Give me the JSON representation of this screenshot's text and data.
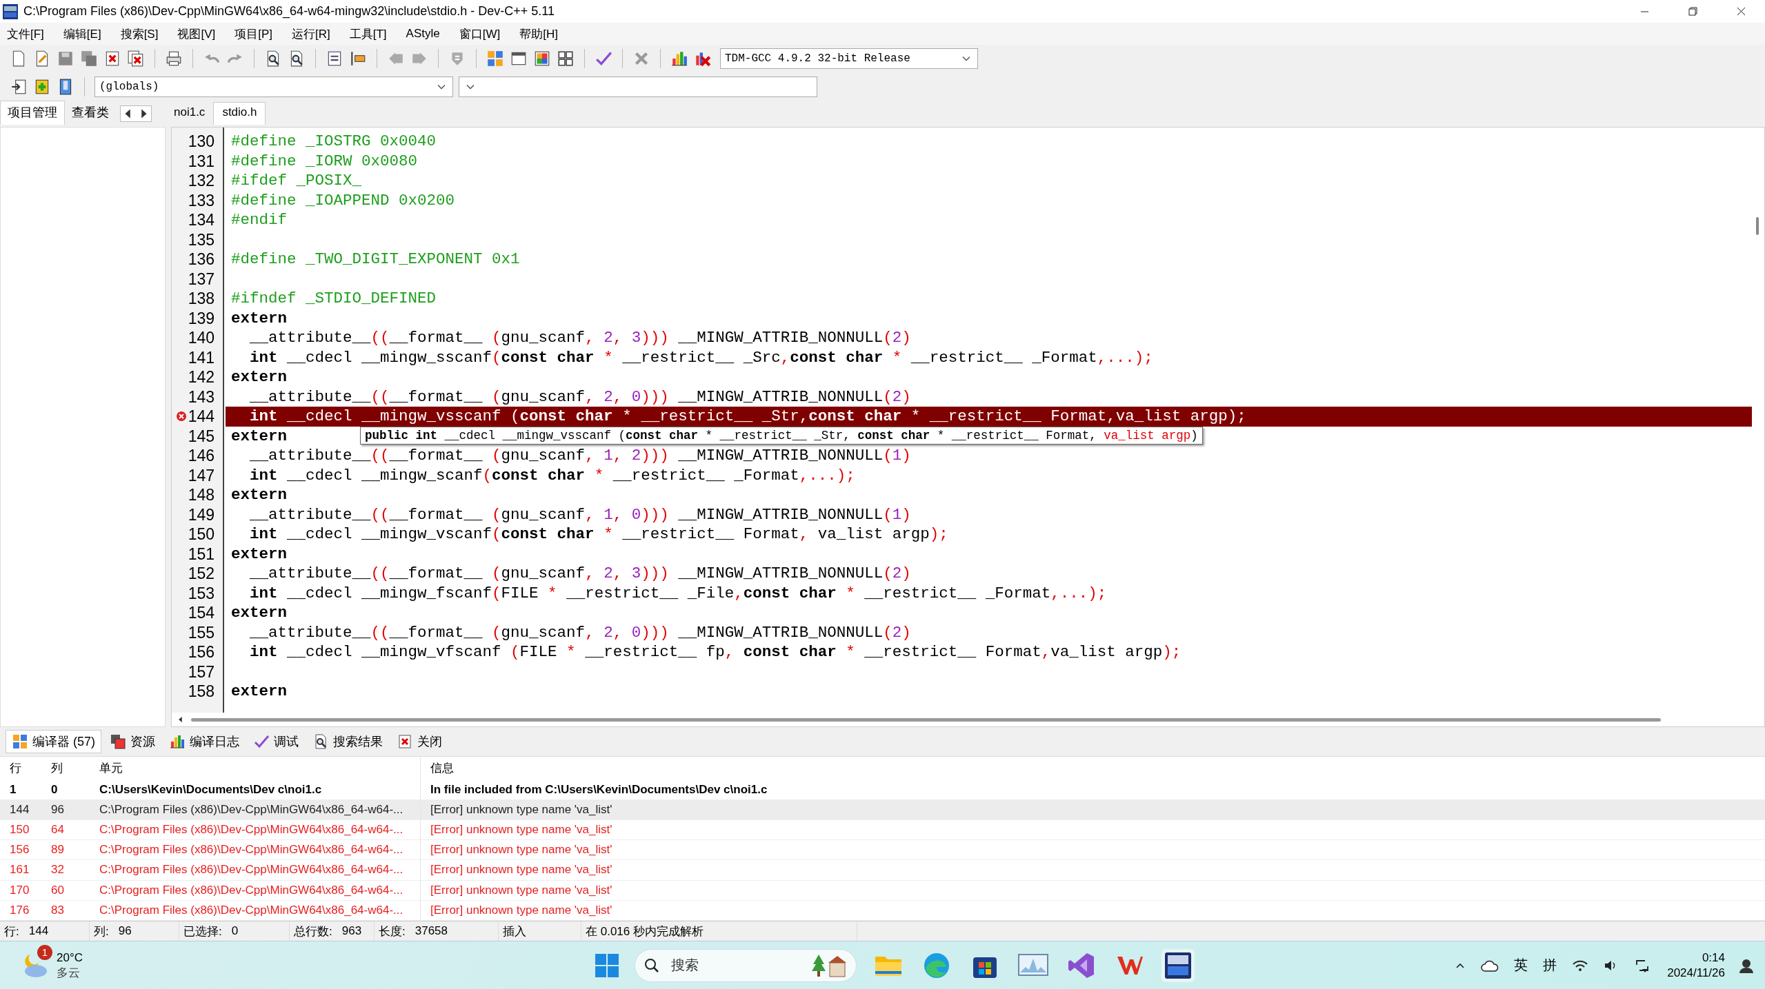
{
  "window": {
    "title": "C:\\Program Files (x86)\\Dev-Cpp\\MinGW64\\x86_64-w64-mingw32\\include\\stdio.h - Dev-C++ 5.11"
  },
  "menu": [
    "文件[F]",
    "编辑[E]",
    "搜索[S]",
    "视图[V]",
    "项目[P]",
    "运行[R]",
    "工具[T]",
    "AStyle",
    "窗口[W]",
    "帮助[H]"
  ],
  "compiler_select": {
    "value": "TDM-GCC 4.9.2 32-bit Release"
  },
  "scope_select": {
    "value": "(globals)"
  },
  "left_tabs": [
    {
      "label": "项目管理",
      "selected": true
    },
    {
      "label": "查看类",
      "selected": false
    }
  ],
  "file_tabs": [
    {
      "label": "noi1.c",
      "selected": false
    },
    {
      "label": "stdio.h",
      "selected": true
    }
  ],
  "editor": {
    "lines": [
      {
        "number": "130",
        "selected": false,
        "error_mark": false,
        "indented": false,
        "tokens": [
          {
            "kind": "pp",
            "text": "#define _IOSTRG 0x0040"
          }
        ]
      },
      {
        "number": "131",
        "selected": false,
        "error_mark": false,
        "indented": false,
        "tokens": [
          {
            "kind": "pp",
            "text": "#define _IORW 0x0080"
          }
        ]
      },
      {
        "number": "132",
        "selected": false,
        "error_mark": false,
        "indented": false,
        "tokens": [
          {
            "kind": "pp",
            "text": "#ifdef _POSIX_"
          }
        ]
      },
      {
        "number": "133",
        "selected": false,
        "error_mark": false,
        "indented": false,
        "tokens": [
          {
            "kind": "pp",
            "text": "#define _IOAPPEND 0x0200"
          }
        ]
      },
      {
        "number": "134",
        "selected": false,
        "error_mark": false,
        "indented": false,
        "tokens": [
          {
            "kind": "pp",
            "text": "#endif"
          }
        ]
      },
      {
        "number": "135",
        "selected": false,
        "error_mark": false
      },
      {
        "number": "136",
        "selected": false,
        "error_mark": false,
        "indented": false,
        "tokens": [
          {
            "kind": "pp",
            "text": "#define _TWO_DIGIT_EXPONENT 0x1"
          }
        ]
      },
      {
        "number": "137",
        "selected": false,
        "error_mark": false
      },
      {
        "number": "138",
        "selected": false,
        "error_mark": false,
        "indented": false,
        "tokens": [
          {
            "kind": "pp",
            "text": "#ifndef _STDIO_DEFINED"
          }
        ]
      },
      {
        "number": "139",
        "selected": false,
        "error_mark": false,
        "indented": false,
        "tokens": [
          {
            "kind": "kw",
            "text": "extern"
          }
        ]
      },
      {
        "number": "140",
        "selected": false,
        "error_mark": false,
        "indented": true,
        "tokens": [
          {
            "kind": "plain",
            "text": "__attribute__"
          },
          {
            "kind": "sym",
            "text": "(("
          },
          {
            "kind": "plain",
            "text": "__format__ "
          },
          {
            "kind": "sym",
            "text": "("
          },
          {
            "kind": "plain",
            "text": "gnu_scanf"
          },
          {
            "kind": "sym",
            "text": ", "
          },
          {
            "kind": "num",
            "text": "2"
          },
          {
            "kind": "sym",
            "text": ", "
          },
          {
            "kind": "num",
            "text": "3"
          },
          {
            "kind": "sym",
            "text": ")))"
          },
          {
            "kind": "plain",
            "text": " __MINGW_ATTRIB_NONNULL"
          },
          {
            "kind": "sym",
            "text": "("
          },
          {
            "kind": "num",
            "text": "2"
          },
          {
            "kind": "sym",
            "text": ")"
          }
        ]
      },
      {
        "number": "141",
        "selected": false,
        "error_mark": false,
        "indented": true,
        "tokens": [
          {
            "kind": "kw",
            "text": "int"
          },
          {
            "kind": "plain",
            "text": " __cdecl __mingw_sscanf"
          },
          {
            "kind": "sym",
            "text": "("
          },
          {
            "kind": "kw",
            "text": "const char"
          },
          {
            "kind": "sym",
            "text": " *"
          },
          {
            "kind": "plain",
            "text": " __restrict__ _Src"
          },
          {
            "kind": "sym",
            "text": ","
          },
          {
            "kind": "kw",
            "text": "const char"
          },
          {
            "kind": "sym",
            "text": " *"
          },
          {
            "kind": "plain",
            "text": " __restrict__ _Format"
          },
          {
            "kind": "sym",
            "text": ",...);"
          }
        ]
      },
      {
        "number": "142",
        "selected": false,
        "error_mark": false,
        "indented": false,
        "tokens": [
          {
            "kind": "kw",
            "text": "extern"
          }
        ]
      },
      {
        "number": "143",
        "selected": false,
        "error_mark": false,
        "indented": true,
        "tokens": [
          {
            "kind": "plain",
            "text": "__attribute__"
          },
          {
            "kind": "sym",
            "text": "(("
          },
          {
            "kind": "plain",
            "text": "__format__ "
          },
          {
            "kind": "sym",
            "text": "("
          },
          {
            "kind": "plain",
            "text": "gnu_scanf"
          },
          {
            "kind": "sym",
            "text": ", "
          },
          {
            "kind": "num",
            "text": "2"
          },
          {
            "kind": "sym",
            "text": ", "
          },
          {
            "kind": "num",
            "text": "0"
          },
          {
            "kind": "sym",
            "text": ")))"
          },
          {
            "kind": "plain",
            "text": " __MINGW_ATTRIB_NONNULL"
          },
          {
            "kind": "sym",
            "text": "("
          },
          {
            "kind": "num",
            "text": "2"
          },
          {
            "kind": "sym",
            "text": ")"
          }
        ]
      },
      {
        "number": "144",
        "selected": true,
        "error_mark": true,
        "indented": true,
        "tokens": [
          {
            "kind": "kw",
            "text": "int"
          },
          {
            "kind": "plain",
            "text": " __cdecl __mingw_vsscanf "
          },
          {
            "kind": "sym",
            "text": "("
          },
          {
            "kind": "kw",
            "text": "const char"
          },
          {
            "kind": "sym",
            "text": " *"
          },
          {
            "kind": "plain",
            "text": " __restrict__ _Str"
          },
          {
            "kind": "sym",
            "text": ","
          },
          {
            "kind": "kw",
            "text": "const char"
          },
          {
            "kind": "sym",
            "text": " *"
          },
          {
            "kind": "plain",
            "text": " __restrict__ Format"
          },
          {
            "kind": "sym",
            "text": ","
          },
          {
            "kind": "plain",
            "text": "va_list argp"
          },
          {
            "kind": "sym",
            "text": ");"
          }
        ]
      },
      {
        "number": "145",
        "selected": false,
        "error_mark": false,
        "indented": false,
        "tokens": [
          {
            "kind": "kw",
            "text": "extern"
          }
        ]
      },
      {
        "number": "146",
        "selected": false,
        "error_mark": false,
        "indented": true,
        "tokens": [
          {
            "kind": "plain",
            "text": "__attribute__"
          },
          {
            "kind": "sym",
            "text": "(("
          },
          {
            "kind": "plain",
            "text": "__format__ "
          },
          {
            "kind": "sym",
            "text": "("
          },
          {
            "kind": "plain",
            "text": "gnu_scanf"
          },
          {
            "kind": "sym",
            "text": ", "
          },
          {
            "kind": "num",
            "text": "1"
          },
          {
            "kind": "sym",
            "text": ", "
          },
          {
            "kind": "num",
            "text": "2"
          },
          {
            "kind": "sym",
            "text": ")))"
          },
          {
            "kind": "plain",
            "text": " __MINGW_ATTRIB_NONNULL"
          },
          {
            "kind": "sym",
            "text": "("
          },
          {
            "kind": "num",
            "text": "1"
          },
          {
            "kind": "sym",
            "text": ")"
          }
        ]
      },
      {
        "number": "147",
        "selected": false,
        "error_mark": false,
        "indented": true,
        "tokens": [
          {
            "kind": "kw",
            "text": "int"
          },
          {
            "kind": "plain",
            "text": " __cdecl __mingw_scanf"
          },
          {
            "kind": "sym",
            "text": "("
          },
          {
            "kind": "kw",
            "text": "const char"
          },
          {
            "kind": "sym",
            "text": " *"
          },
          {
            "kind": "plain",
            "text": " __restrict__ _Format"
          },
          {
            "kind": "sym",
            "text": ",...);"
          }
        ]
      },
      {
        "number": "148",
        "selected": false,
        "error_mark": false,
        "indented": false,
        "tokens": [
          {
            "kind": "kw",
            "text": "extern"
          }
        ]
      },
      {
        "number": "149",
        "selected": false,
        "error_mark": false,
        "indented": true,
        "tokens": [
          {
            "kind": "plain",
            "text": "__attribute__"
          },
          {
            "kind": "sym",
            "text": "(("
          },
          {
            "kind": "plain",
            "text": "__format__ "
          },
          {
            "kind": "sym",
            "text": "("
          },
          {
            "kind": "plain",
            "text": "gnu_scanf"
          },
          {
            "kind": "sym",
            "text": ", "
          },
          {
            "kind": "num",
            "text": "1"
          },
          {
            "kind": "sym",
            "text": ", "
          },
          {
            "kind": "num",
            "text": "0"
          },
          {
            "kind": "sym",
            "text": ")))"
          },
          {
            "kind": "plain",
            "text": " __MINGW_ATTRIB_NONNULL"
          },
          {
            "kind": "sym",
            "text": "("
          },
          {
            "kind": "num",
            "text": "1"
          },
          {
            "kind": "sym",
            "text": ")"
          }
        ]
      },
      {
        "number": "150",
        "selected": false,
        "error_mark": false,
        "indented": true,
        "tokens": [
          {
            "kind": "kw",
            "text": "int"
          },
          {
            "kind": "plain",
            "text": " __cdecl __mingw_vscanf"
          },
          {
            "kind": "sym",
            "text": "("
          },
          {
            "kind": "kw",
            "text": "const char"
          },
          {
            "kind": "sym",
            "text": " *"
          },
          {
            "kind": "plain",
            "text": " __restrict__ Format"
          },
          {
            "kind": "sym",
            "text": ","
          },
          {
            "kind": "plain",
            "text": " va_list argp"
          },
          {
            "kind": "sym",
            "text": ");"
          }
        ]
      },
      {
        "number": "151",
        "selected": false,
        "error_mark": false,
        "indented": false,
        "tokens": [
          {
            "kind": "kw",
            "text": "extern"
          }
        ]
      },
      {
        "number": "152",
        "selected": false,
        "error_mark": false,
        "indented": true,
        "tokens": [
          {
            "kind": "plain",
            "text": "__attribute__"
          },
          {
            "kind": "sym",
            "text": "(("
          },
          {
            "kind": "plain",
            "text": "__format__ "
          },
          {
            "kind": "sym",
            "text": "("
          },
          {
            "kind": "plain",
            "text": "gnu_scanf"
          },
          {
            "kind": "sym",
            "text": ", "
          },
          {
            "kind": "num",
            "text": "2"
          },
          {
            "kind": "sym",
            "text": ", "
          },
          {
            "kind": "num",
            "text": "3"
          },
          {
            "kind": "sym",
            "text": ")))"
          },
          {
            "kind": "plain",
            "text": " __MINGW_ATTRIB_NONNULL"
          },
          {
            "kind": "sym",
            "text": "("
          },
          {
            "kind": "num",
            "text": "2"
          },
          {
            "kind": "sym",
            "text": ")"
          }
        ]
      },
      {
        "number": "153",
        "selected": false,
        "error_mark": false,
        "indented": true,
        "tokens": [
          {
            "kind": "kw",
            "text": "int"
          },
          {
            "kind": "plain",
            "text": " __cdecl __mingw_fscanf"
          },
          {
            "kind": "sym",
            "text": "("
          },
          {
            "kind": "plain",
            "text": "FILE "
          },
          {
            "kind": "sym",
            "text": "*"
          },
          {
            "kind": "plain",
            "text": " __restrict__ _File"
          },
          {
            "kind": "sym",
            "text": ","
          },
          {
            "kind": "kw",
            "text": "const char"
          },
          {
            "kind": "sym",
            "text": " *"
          },
          {
            "kind": "plain",
            "text": " __restrict__ _Format"
          },
          {
            "kind": "sym",
            "text": ",...);"
          }
        ]
      },
      {
        "number": "154",
        "selected": false,
        "error_mark": false,
        "indented": false,
        "tokens": [
          {
            "kind": "kw",
            "text": "extern"
          }
        ]
      },
      {
        "number": "155",
        "selected": false,
        "error_mark": false,
        "indented": true,
        "tokens": [
          {
            "kind": "plain",
            "text": "__attribute__"
          },
          {
            "kind": "sym",
            "text": "(("
          },
          {
            "kind": "plain",
            "text": "__format__ "
          },
          {
            "kind": "sym",
            "text": "("
          },
          {
            "kind": "plain",
            "text": "gnu_scanf"
          },
          {
            "kind": "sym",
            "text": ", "
          },
          {
            "kind": "num",
            "text": "2"
          },
          {
            "kind": "sym",
            "text": ", "
          },
          {
            "kind": "num",
            "text": "0"
          },
          {
            "kind": "sym",
            "text": ")))"
          },
          {
            "kind": "plain",
            "text": " __MINGW_ATTRIB_NONNULL"
          },
          {
            "kind": "sym",
            "text": "("
          },
          {
            "kind": "num",
            "text": "2"
          },
          {
            "kind": "sym",
            "text": ")"
          }
        ]
      },
      {
        "number": "156",
        "selected": false,
        "error_mark": false,
        "indented": true,
        "tokens": [
          {
            "kind": "kw",
            "text": "int"
          },
          {
            "kind": "plain",
            "text": " __cdecl __mingw_vfscanf "
          },
          {
            "kind": "sym",
            "text": "("
          },
          {
            "kind": "plain",
            "text": "FILE "
          },
          {
            "kind": "sym",
            "text": "*"
          },
          {
            "kind": "plain",
            "text": " __restrict__ fp"
          },
          {
            "kind": "sym",
            "text": ", "
          },
          {
            "kind": "kw",
            "text": "const char"
          },
          {
            "kind": "sym",
            "text": " *"
          },
          {
            "kind": "plain",
            "text": " __restrict__ Format"
          },
          {
            "kind": "sym",
            "text": ","
          },
          {
            "kind": "plain",
            "text": "va_list argp"
          },
          {
            "kind": "sym",
            "text": ");"
          }
        ]
      },
      {
        "number": "157",
        "selected": false,
        "error_mark": false
      },
      {
        "number": "158",
        "selected": false,
        "error_mark": false,
        "indented": false,
        "tokens": [
          {
            "kind": "kw",
            "text": "extern"
          }
        ]
      }
    ]
  },
  "tooltip": {
    "tokens": [
      {
        "kind": "kw",
        "text": "public int"
      },
      {
        "kind": "plain",
        "text": " __cdecl __mingw_vsscanf ("
      },
      {
        "kind": "kw",
        "text": "const char"
      },
      {
        "kind": "plain",
        "text": " * __restrict__ _Str, "
      },
      {
        "kind": "kw",
        "text": "const char"
      },
      {
        "kind": "plain",
        "text": " * __restrict__ Format, "
      },
      {
        "kind": "arg",
        "text": "va_list argp"
      },
      {
        "kind": "plain",
        "text": ")"
      }
    ]
  },
  "bottom_tabs": [
    {
      "label": "编译器 (57)",
      "selected": true
    },
    {
      "label": "资源",
      "selected": false
    },
    {
      "label": "编译日志",
      "selected": false
    },
    {
      "label": "调试",
      "selected": false
    },
    {
      "label": "搜索结果",
      "selected": false
    },
    {
      "label": "关闭",
      "selected": false
    }
  ],
  "messages": {
    "columns": [
      "行",
      "列",
      "单元",
      "信息"
    ],
    "rows": [
      {
        "line": "1",
        "column": "0",
        "unit": "C:\\Users\\Kevin\\Documents\\Dev c\\noi1.c",
        "message": "In file included from C:\\Users\\Kevin\\Documents\\Dev c\\noi1.c",
        "kind": "note",
        "selected": false
      },
      {
        "line": "144",
        "column": "96",
        "unit": "C:\\Program Files (x86)\\Dev-Cpp\\MinGW64\\x86_64-w64-...",
        "message": "[Error] unknown type name 'va_list'",
        "kind": "error",
        "selected": true
      },
      {
        "line": "150",
        "column": "64",
        "unit": "C:\\Program Files (x86)\\Dev-Cpp\\MinGW64\\x86_64-w64-...",
        "message": "[Error] unknown type name 'va_list'",
        "kind": "error",
        "selected": false
      },
      {
        "line": "156",
        "column": "89",
        "unit": "C:\\Program Files (x86)\\Dev-Cpp\\MinGW64\\x86_64-w64-...",
        "message": "[Error] unknown type name 'va_list'",
        "kind": "error",
        "selected": false
      },
      {
        "line": "161",
        "column": "32",
        "unit": "C:\\Program Files (x86)\\Dev-Cpp\\MinGW64\\x86_64-w64-...",
        "message": "[Error] unknown type name 'va_list'",
        "kind": "error",
        "selected": false
      },
      {
        "line": "170",
        "column": "60",
        "unit": "C:\\Program Files (x86)\\Dev-Cpp\\MinGW64\\x86_64-w64-...",
        "message": "[Error] unknown type name 'va_list'",
        "kind": "error",
        "selected": false
      },
      {
        "line": "176",
        "column": "83",
        "unit": "C:\\Program Files (x86)\\Dev-Cpp\\MinGW64\\x86_64-w64-...",
        "message": "[Error] unknown type name 'va_list'",
        "kind": "error",
        "selected": false
      }
    ]
  },
  "status_bar": [
    {
      "label": "行:",
      "value": "144"
    },
    {
      "label": "列:",
      "value": "96"
    },
    {
      "label": "已选择:",
      "value": "0"
    },
    {
      "label": "总行数:",
      "value": "963"
    },
    {
      "label": "长度:",
      "value": "37658"
    },
    {
      "label": "插入"
    },
    {
      "label": "在 0.016 秒内完成解析"
    }
  ],
  "taskbar": {
    "weather": {
      "badge": "1",
      "temperature": "20°C",
      "condition": "多云"
    },
    "search": {
      "placeholder": "搜索"
    },
    "tray": [
      "英",
      "拼"
    ],
    "clock": {
      "time": "0:14",
      "date": "2024/11/26"
    }
  }
}
